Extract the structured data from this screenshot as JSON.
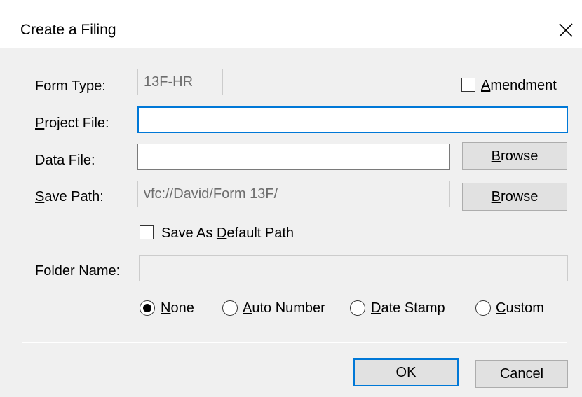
{
  "window": {
    "title": "Create a Filing",
    "close_icon": "close-icon"
  },
  "form_type": {
    "label": "Form Type:",
    "value": "13F-HR"
  },
  "amendment": {
    "label_mnemonic": "A",
    "label_rest": "mendment",
    "checked": false
  },
  "project_file": {
    "label_mnemonic": "P",
    "label_rest": "roject File:",
    "value": ""
  },
  "data_file": {
    "label": "Data File:",
    "value": "",
    "browse_mnemonic": "B",
    "browse_rest": "rowse"
  },
  "save_path": {
    "label_mnemonic": "S",
    "label_rest": "ave Path:",
    "value": "vfc://David/Form 13F/",
    "browse_mnemonic": "B",
    "browse_rest": "rowse"
  },
  "save_default": {
    "label_pre": "Save As ",
    "label_mnemonic": "D",
    "label_rest": "efault Path",
    "checked": false
  },
  "folder_name": {
    "label": "Folder Name:",
    "value": ""
  },
  "naming_options": [
    {
      "mnemonic": "N",
      "rest": "one",
      "selected": true
    },
    {
      "mnemonic": "A",
      "rest": "uto Number",
      "selected": false
    },
    {
      "mnemonic": "D",
      "rest": "ate Stamp",
      "selected": false
    },
    {
      "mnemonic": "C",
      "rest": "ustom",
      "selected": false
    }
  ],
  "buttons": {
    "ok": "OK",
    "cancel": "Cancel"
  },
  "colors": {
    "accent": "#0078d7",
    "dialog_bg": "#f0f0f0"
  }
}
